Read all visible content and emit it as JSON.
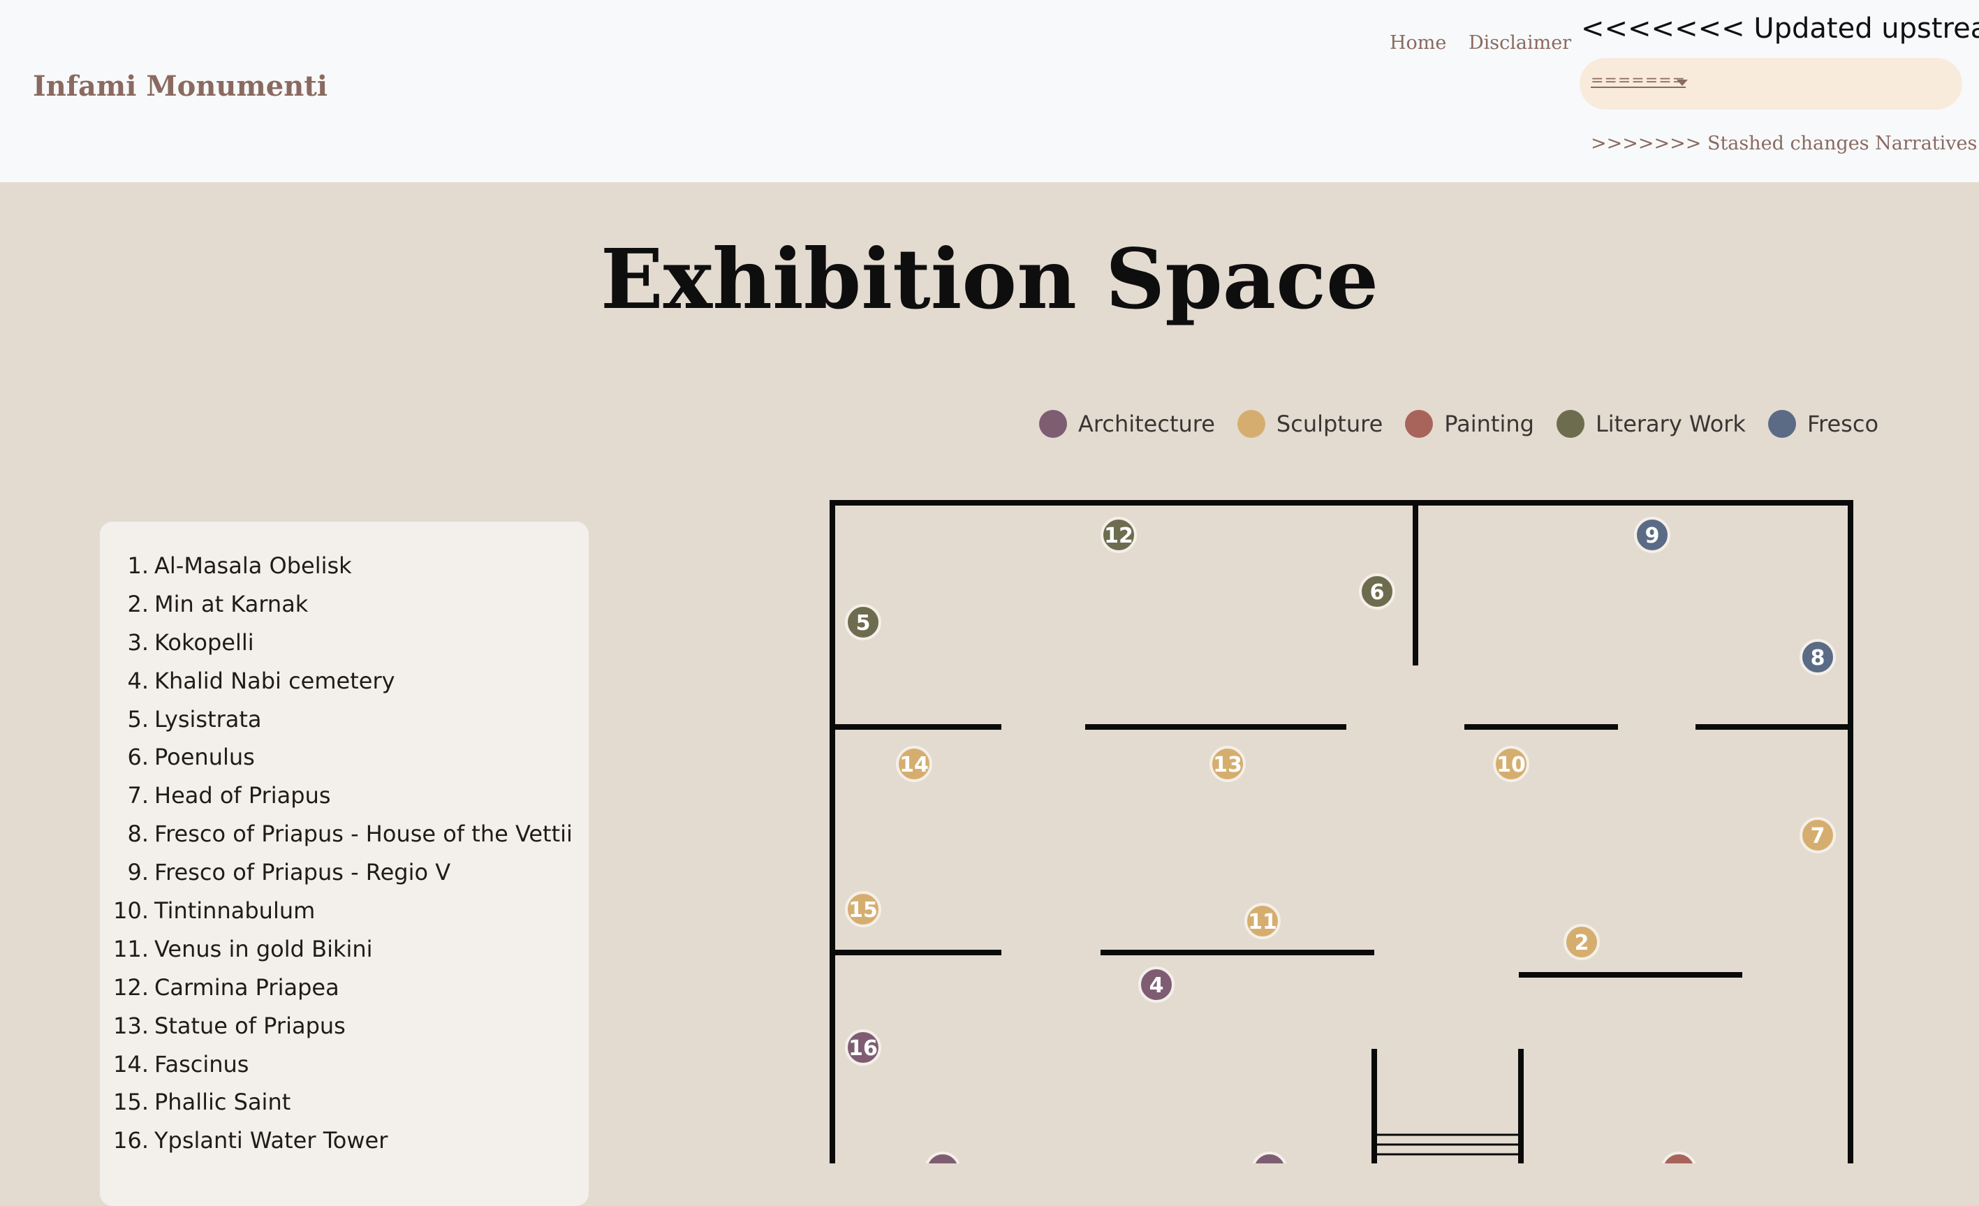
{
  "header": {
    "brand": "Infami Monumenti",
    "nav": {
      "home": "Home",
      "disclaimer": "Disclaimer"
    },
    "merge_marker_upstream": "<<<<<<< Updated upstream",
    "merge_marker_divider": "=======",
    "stashed_label": ">>>>>>> Stashed changes Narratives"
  },
  "page": {
    "title": "Exhibition Space"
  },
  "legend": [
    {
      "label": "Architecture",
      "color": "#7e5d73"
    },
    {
      "label": "Sculpture",
      "color": "#d5ae6f"
    },
    {
      "label": "Painting",
      "color": "#a8645a"
    },
    {
      "label": "Literary Work",
      "color": "#6e6c4e"
    },
    {
      "label": "Fresco",
      "color": "#5b6b86"
    }
  ],
  "items": [
    {
      "num": "1.",
      "name": "Al-Masala Obelisk"
    },
    {
      "num": "2.",
      "name": "Min at Karnak"
    },
    {
      "num": "3.",
      "name": "Kokopelli"
    },
    {
      "num": "4.",
      "name": "Khalid Nabi cemetery"
    },
    {
      "num": "5.",
      "name": "Lysistrata"
    },
    {
      "num": "6.",
      "name": "Poenulus"
    },
    {
      "num": "7.",
      "name": "Head of Priapus"
    },
    {
      "num": "8.",
      "name": "Fresco of Priapus - House of the Vettii"
    },
    {
      "num": "9.",
      "name": "Fresco of Priapus - Regio V"
    },
    {
      "num": "10.",
      "name": "Tintinnabulum"
    },
    {
      "num": "11.",
      "name": "Venus in gold Bikini"
    },
    {
      "num": "12.",
      "name": "Carmina Priapea"
    },
    {
      "num": "13.",
      "name": "Statue of Priapus"
    },
    {
      "num": "14.",
      "name": "Fascinus"
    },
    {
      "num": "15.",
      "name": "Phallic Saint"
    },
    {
      "num": "16.",
      "name": "Ypslanti Water Tower"
    }
  ],
  "markers": [
    {
      "label": "12",
      "category": "Literary Work"
    },
    {
      "label": "9",
      "category": "Fresco"
    },
    {
      "label": "6",
      "category": "Literary Work"
    },
    {
      "label": "5",
      "category": "Literary Work"
    },
    {
      "label": "8",
      "category": "Fresco"
    },
    {
      "label": "14",
      "category": "Sculpture"
    },
    {
      "label": "13",
      "category": "Sculpture"
    },
    {
      "label": "10",
      "category": "Sculpture"
    },
    {
      "label": "7",
      "category": "Sculpture"
    },
    {
      "label": "15",
      "category": "Sculpture"
    },
    {
      "label": "11",
      "category": "Sculpture"
    },
    {
      "label": "2",
      "category": "Sculpture"
    },
    {
      "label": "4",
      "category": "Architecture"
    },
    {
      "label": "16",
      "category": "Architecture"
    },
    {
      "label": "",
      "category": "Architecture"
    },
    {
      "label": "",
      "category": "Architecture"
    },
    {
      "label": "",
      "category": "Painting"
    }
  ]
}
